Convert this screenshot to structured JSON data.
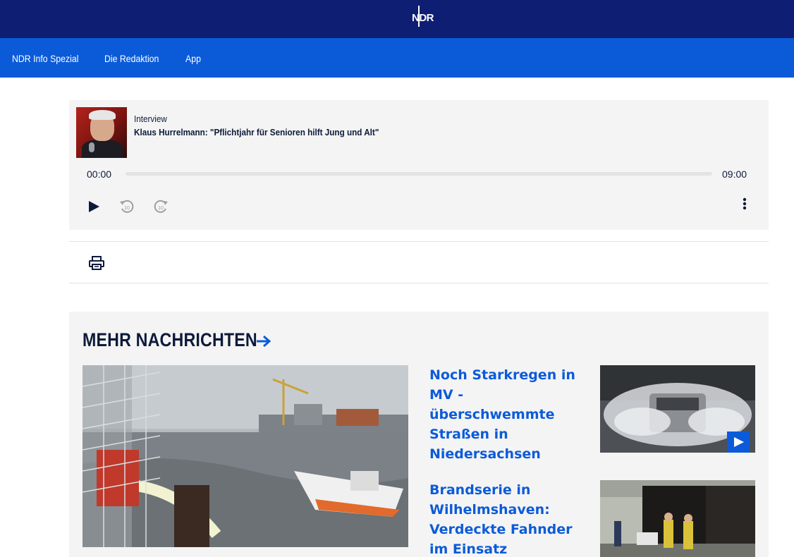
{
  "header": {
    "logo_text": "NDR",
    "nav": [
      {
        "label": "NDR Info Spezial"
      },
      {
        "label": "Die Redaktion"
      },
      {
        "label": "App"
      }
    ]
  },
  "player": {
    "kicker": "Interview",
    "title": "Klaus Hurrelmann: \"Pflichtjahr für Senioren hilft Jung und Alt\"",
    "current_time": "00:00",
    "duration": "09:00",
    "progress": 0,
    "rewind_label": "10",
    "forward_label": "10",
    "icons": [
      "play-icon",
      "rewind-10-icon",
      "forward-10-icon",
      "more-options-icon"
    ]
  },
  "toolbar": {
    "icons": [
      "print-icon"
    ]
  },
  "more_news": {
    "heading": "MEHR NACHRICHTEN",
    "articles": [
      {
        "title": "Noch Starkregen in MV - überschwemmte Straßen in Niedersachsen",
        "has_video": true
      },
      {
        "title": "Brandserie in Wilhelmshaven: Verdeckte Fahnder im Einsatz",
        "has_video": false
      }
    ]
  },
  "colors": {
    "header_bg": "#0d1e73",
    "nav_bg": "#0b5bd9",
    "link": "#0b5bd9",
    "text": "#0d1a3a",
    "panel_bg": "#f4f4f4"
  }
}
